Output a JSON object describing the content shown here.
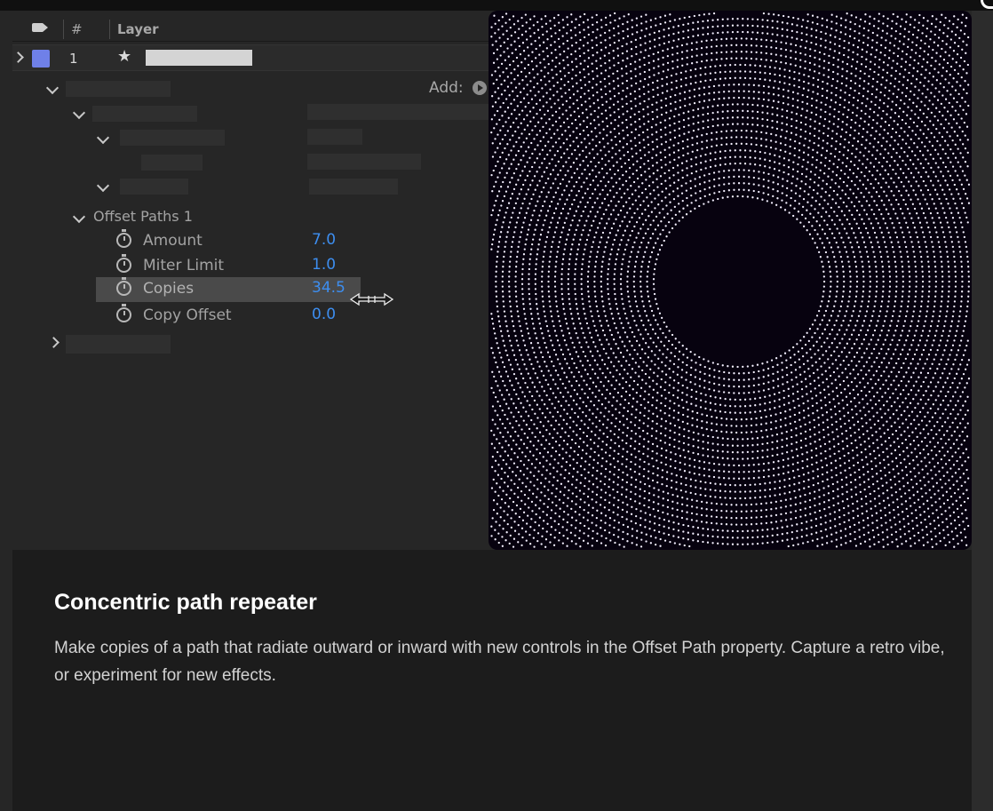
{
  "layer_panel": {
    "columns": {
      "number": "#",
      "layer": "Layer"
    },
    "layer": {
      "index": "1",
      "color": "#6f80e8"
    },
    "add_label": "Add:",
    "group": {
      "name": "Offset Paths 1"
    },
    "properties": [
      {
        "name": "Amount",
        "value": "7.0",
        "selected": false
      },
      {
        "name": "Miter Limit",
        "value": "1.0",
        "selected": false
      },
      {
        "name": "Copies",
        "value": "34.5",
        "selected": true
      },
      {
        "name": "Copy Offset",
        "value": "0.0",
        "selected": false
      }
    ]
  },
  "preview": {
    "background": "#07020f",
    "dot_color": "#f4f0ff"
  },
  "card": {
    "title": "Concentric path repeater",
    "description": "Make copies of a path that radiate outward or inward with new controls in the Offset Path property. Capture a retro vibe, or experiment for new effects."
  },
  "colors": {
    "value_blue": "#3d8ef0"
  }
}
